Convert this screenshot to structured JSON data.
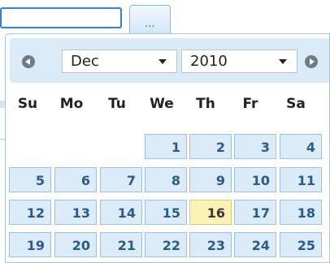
{
  "input": {
    "value": "",
    "placeholder": ""
  },
  "trigger": {
    "label": "..."
  },
  "header": {
    "month": "Dec",
    "year": "2010"
  },
  "weekdays": [
    "Su",
    "Mo",
    "Tu",
    "We",
    "Th",
    "Fr",
    "Sa"
  ],
  "weeks": [
    [
      "",
      "",
      "",
      "",
      "1",
      "2",
      "3",
      "4"
    ],
    [
      "5",
      "6",
      "7",
      "8",
      "9",
      "10",
      "11"
    ],
    [
      "12",
      "13",
      "14",
      "15",
      "16",
      "17",
      "18"
    ],
    [
      "19",
      "20",
      "21",
      "22",
      "23",
      "24",
      "25"
    ]
  ],
  "today": "16",
  "colors": {
    "focus": "#2f82d6",
    "header": "#dbeaf7",
    "day": "#dcebf8",
    "today": "#fbf3b6"
  },
  "icons": {
    "prev": "chevron-left-icon",
    "next": "chevron-right-icon",
    "dropdown": "caret-down-icon"
  }
}
